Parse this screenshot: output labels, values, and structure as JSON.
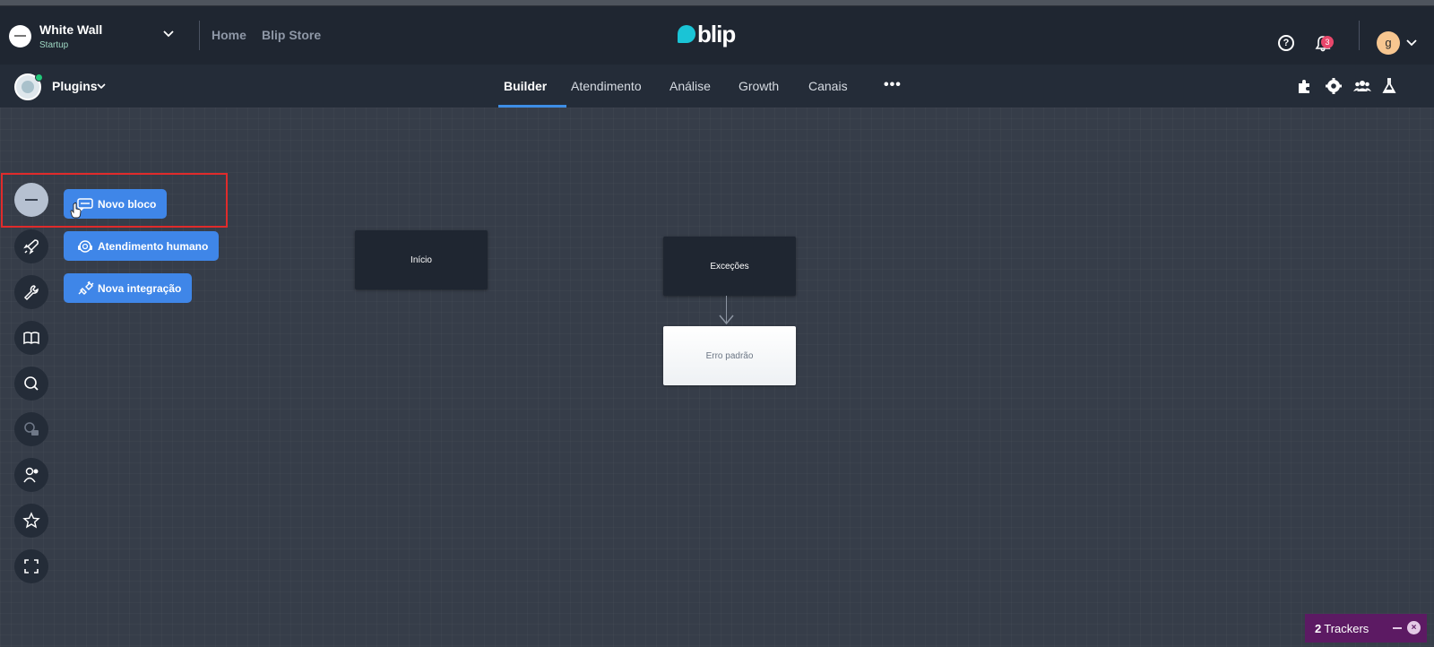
{
  "org": {
    "name": "White Wall",
    "plan": "Startup"
  },
  "nav": {
    "home": "Home",
    "store": "Blip Store"
  },
  "brand": {
    "name": "blip",
    "color": "#1ac4d6"
  },
  "header": {
    "help": "?",
    "notifications_count": "3",
    "avatar_letter": "g"
  },
  "subheader": {
    "plugins_label": "Plugins",
    "tabs": [
      {
        "label": "Builder",
        "active": true
      },
      {
        "label": "Atendimento"
      },
      {
        "label": "Análise"
      },
      {
        "label": "Growth"
      },
      {
        "label": "Canais"
      }
    ],
    "more": "•••",
    "icons": [
      "puzzle-icon",
      "gear-icon",
      "team-icon",
      "flask-icon"
    ]
  },
  "sidebar": {
    "items": [
      "collapse-icon",
      "rocket-icon",
      "wrench-icon",
      "book-icon",
      "search-icon",
      "settings-lock-icon",
      "user-icon",
      "star-icon",
      "fullscreen-icon"
    ]
  },
  "actions": {
    "novo_bloco": "Novo bloco",
    "atendimento_humano": "Atendimento humano",
    "nova_integracao": "Nova integração"
  },
  "blocks": {
    "inicio": "Início",
    "excecoes": "Exceções",
    "erro_padrao": "Erro padrão"
  },
  "trackers": {
    "count": "2",
    "label": "Trackers",
    "close": "×"
  },
  "colors": {
    "accent": "#3f86e8",
    "highlight": "#e02b2b",
    "trackers_bg": "#5c1a63"
  }
}
